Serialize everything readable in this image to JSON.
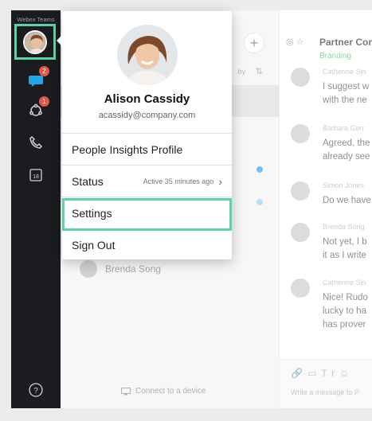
{
  "app": {
    "title": "Webex Teams"
  },
  "rail": {
    "messages_badge": "2",
    "teams_badge": "1",
    "calendar_label": "18",
    "help_label": "?"
  },
  "list": {
    "sort_label": "by",
    "contact_name": "Brenda Song",
    "connect_label": "Connect to a device"
  },
  "conversation": {
    "title": "Partner Cor",
    "subtitle": "Branding",
    "messages": [
      {
        "name": "Catherine Sin",
        "line1": "I suggest w",
        "line2": "with the ne"
      },
      {
        "name": "Barbara Gerr",
        "line1": "Agreed, the",
        "line2": "already see"
      },
      {
        "name": "Simon Jones",
        "line1": "Do we have"
      },
      {
        "name": "Brenda Song",
        "line1": "Not yet, I b",
        "line2": "it as I write"
      },
      {
        "name": "Catherine Sin",
        "line1": "Nice! Rudo",
        "line2": "lucky to ha",
        "line3": "has prover"
      }
    ],
    "composer_placeholder": "Write a message to P"
  },
  "profile": {
    "name": "Alison Cassidy",
    "email": "acassidy@company.com"
  },
  "menu": {
    "insights": "People Insights Profile",
    "status": "Status",
    "status_detail": "Active 35 minutes ago",
    "settings": "Settings",
    "signout": "Sign Out"
  },
  "colors": {
    "highlight": "#5fd3a8",
    "rail": "#1a1c20",
    "badge": "#e2574c",
    "accent_blue": "#29a3e6"
  }
}
